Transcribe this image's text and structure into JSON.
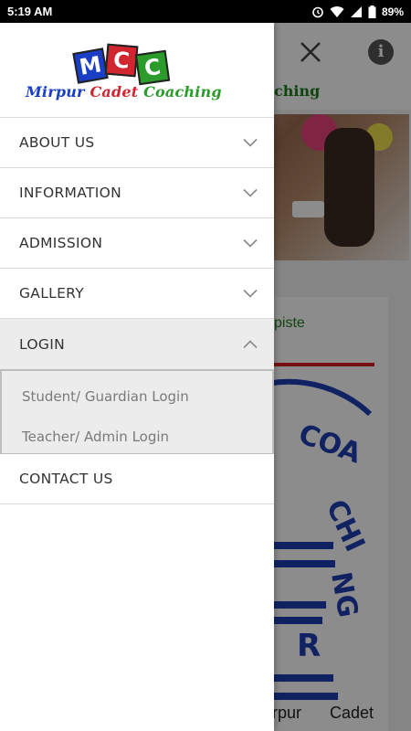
{
  "status_bar": {
    "time": "5:19 AM",
    "battery": "89%"
  },
  "background": {
    "subtitle": "ching",
    "card_title": "piste",
    "footer_text": "rpur Cadet",
    "logo_text_1": "COACHING",
    "logo_text_2": "R"
  },
  "drawer": {
    "logo": {
      "letters": [
        "M",
        "C",
        "C"
      ],
      "colors": {
        "m": "#1a3fc6",
        "c1": "#d0262f",
        "c2": "#2b9b2b"
      },
      "text_parts": [
        {
          "text": "Mirpur ",
          "color": "#1a3fc6"
        },
        {
          "text": "Cadet ",
          "color": "#d0262f"
        },
        {
          "text": "Coaching",
          "color": "#2b9b2b"
        }
      ]
    },
    "menu": [
      {
        "label": "ABOUT US",
        "icon": "chevron-down-icon"
      },
      {
        "label": "INFORMATION",
        "icon": "chevron-down-icon"
      },
      {
        "label": "ADMISSION",
        "icon": "chevron-down-icon"
      },
      {
        "label": "GALLERY",
        "icon": "chevron-down-icon"
      },
      {
        "label": "LOGIN",
        "icon": "chevron-up-icon",
        "expanded": true,
        "children": [
          "Student/ Guardian Login",
          "Teacher/ Admin Login"
        ]
      },
      {
        "label": "CONTACT US"
      }
    ]
  }
}
